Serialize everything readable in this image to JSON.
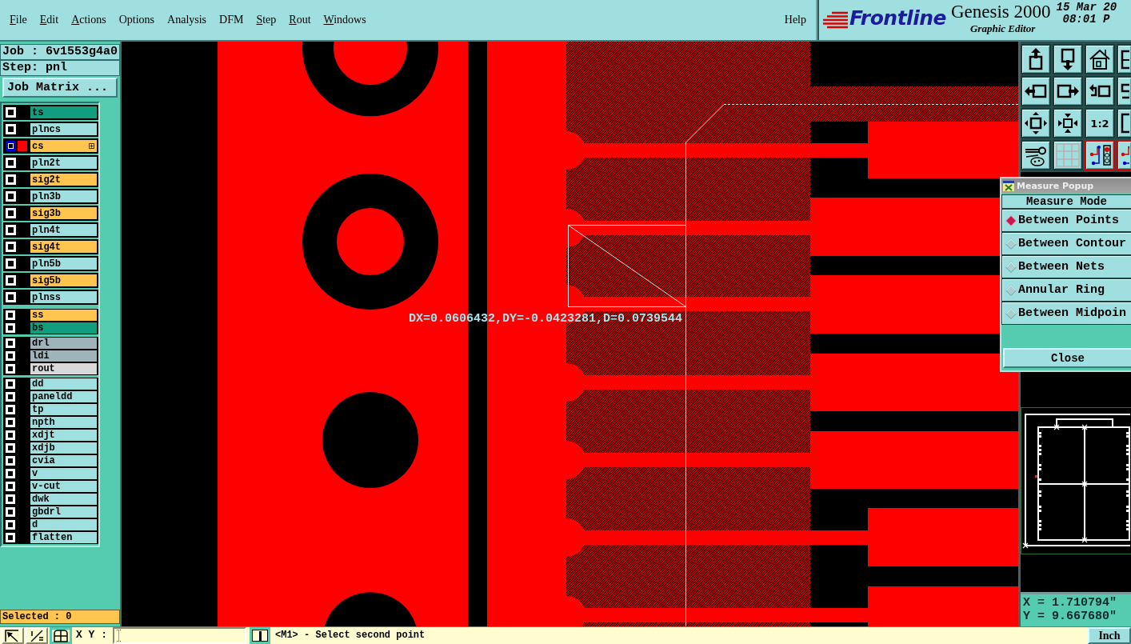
{
  "menu": {
    "items": [
      {
        "label": "File",
        "mnemonic": true
      },
      {
        "label": "Edit",
        "mnemonic": true
      },
      {
        "label": "Actions",
        "mnemonic": true
      },
      {
        "label": "Options",
        "mnemonic": false
      },
      {
        "label": "Analysis",
        "mnemonic": false
      },
      {
        "label": "DFM",
        "mnemonic": false
      },
      {
        "label": "Step",
        "mnemonic": true
      },
      {
        "label": "Rout",
        "mnemonic": true
      },
      {
        "label": "Windows",
        "mnemonic": true
      }
    ],
    "help": {
      "label": "Help",
      "mnemonic": false
    }
  },
  "brand": {
    "logo": "Frontline",
    "product": "Genesis 2000",
    "subtitle": "Graphic Editor",
    "date": "15 Mar 20",
    "time": "08:01 P"
  },
  "job_panel": {
    "job": "Job : 6v1553g4a0",
    "step": "Step: pnl",
    "matrix_button": "Job Matrix ...",
    "layer_groups": [
      {
        "kind": "spaced",
        "layers": [
          {
            "name": "ts",
            "color": "#129e7e",
            "affected": false,
            "selected": false
          },
          {
            "name": "plncs",
            "color": "#9fdfdf",
            "affected": false,
            "selected": false
          },
          {
            "name": "cs",
            "color": "#ffc54e",
            "affected": true,
            "selected": true,
            "display": {
              "color": "#ff0000"
            }
          },
          {
            "name": "pln2t",
            "color": "#9fdfdf",
            "affected": false,
            "selected": false
          },
          {
            "name": "sig2t",
            "color": "#ffc54e",
            "affected": false,
            "selected": false
          },
          {
            "name": "pln3b",
            "color": "#9fdfdf",
            "affected": false,
            "selected": false
          },
          {
            "name": "sig3b",
            "color": "#ffc54e",
            "affected": false,
            "selected": false
          },
          {
            "name": "pln4t",
            "color": "#9fdfdf",
            "affected": false,
            "selected": false
          },
          {
            "name": "sig4t",
            "color": "#ffc54e",
            "affected": false,
            "selected": false
          },
          {
            "name": "pln5b",
            "color": "#9fdfdf",
            "affected": false,
            "selected": false
          },
          {
            "name": "sig5b",
            "color": "#ffc54e",
            "affected": false,
            "selected": false
          },
          {
            "name": "plnss",
            "color": "#9fdfdf",
            "affected": false,
            "selected": false
          }
        ]
      },
      {
        "kind": "stacked",
        "layers": [
          {
            "name": "ss",
            "color": "#ffc54e",
            "affected": false,
            "selected": false
          },
          {
            "name": "bs",
            "color": "#129e7e",
            "affected": false,
            "selected": false
          }
        ]
      },
      {
        "kind": "stacked",
        "layers": [
          {
            "name": "drl",
            "color": "#9fb3bb",
            "affected": false,
            "selected": false
          },
          {
            "name": "ldi",
            "color": "#9fb3bb",
            "affected": false,
            "selected": false
          },
          {
            "name": "rout",
            "color": "#d9d9d9",
            "affected": false,
            "selected": false
          }
        ]
      },
      {
        "kind": "stacked",
        "layers": [
          {
            "name": "dd",
            "color": "#9fdfdf",
            "affected": false,
            "selected": false
          },
          {
            "name": "paneldd",
            "color": "#9fdfdf",
            "affected": false,
            "selected": false
          },
          {
            "name": "tp",
            "color": "#9fdfdf",
            "affected": false,
            "selected": false
          },
          {
            "name": "npth",
            "color": "#9fdfdf",
            "affected": false,
            "selected": false
          },
          {
            "name": "xdjt",
            "color": "#9fdfdf",
            "affected": false,
            "selected": false
          },
          {
            "name": "xdjb",
            "color": "#9fdfdf",
            "affected": false,
            "selected": false
          },
          {
            "name": "cvia",
            "color": "#9fdfdf",
            "affected": false,
            "selected": false
          },
          {
            "name": "v",
            "color": "#9fdfdf",
            "affected": false,
            "selected": false
          },
          {
            "name": "v-cut",
            "color": "#9fdfdf",
            "affected": false,
            "selected": false
          },
          {
            "name": "dwk",
            "color": "#9fdfdf",
            "affected": false,
            "selected": false
          },
          {
            "name": "gbdrl",
            "color": "#9fdfdf",
            "affected": false,
            "selected": false
          },
          {
            "name": "d",
            "color": "#9fdfdf",
            "affected": false,
            "selected": false
          },
          {
            "name": "flatten",
            "color": "#9fdfdf",
            "affected": false,
            "selected": false
          }
        ]
      }
    ],
    "selected_count": "Selected : 0"
  },
  "canvas": {
    "measurement": "DX=0.0606432,DY=-0.0423281,D=0.0739544"
  },
  "toolbar": {
    "buttons": [
      {
        "kind": "icon",
        "on": false
      },
      {
        "kind": "icon",
        "on": false
      },
      {
        "kind": "icon",
        "on": false
      },
      {
        "kind": "icon",
        "on": false
      },
      {
        "kind": "icon",
        "on": false
      },
      {
        "kind": "icon",
        "on": false
      },
      {
        "kind": "icon",
        "on": false
      },
      {
        "kind": "icon",
        "on": false
      },
      {
        "kind": "icon",
        "on": false
      },
      {
        "kind": "icon",
        "on": false
      },
      {
        "kind": "text",
        "label": "1:2",
        "on": false
      },
      {
        "kind": "icon",
        "on": false
      },
      {
        "kind": "icon",
        "on": false
      },
      {
        "kind": "icon",
        "on": false
      },
      {
        "kind": "icon",
        "on": true
      },
      {
        "kind": "icon",
        "on": true
      }
    ]
  },
  "measure_popup": {
    "title": "Measure Popup",
    "heading": "Measure Mode",
    "modes": [
      {
        "label": "Between Points",
        "selected": true
      },
      {
        "label": "Between Contour",
        "selected": false
      },
      {
        "label": "Between Nets",
        "selected": false
      },
      {
        "label": "Annular Ring",
        "selected": false
      },
      {
        "label": "Between Midpoin",
        "selected": false
      }
    ],
    "close_label": "Close"
  },
  "coordinates": {
    "x": "X = 1.710794\"",
    "y": "Y = 9.667680\""
  },
  "status_bar": {
    "tools": [
      {
        "on": false
      },
      {
        "on": false
      },
      {
        "on": true
      }
    ],
    "xy_label": "X Y :",
    "message": "<M1> - Select second point",
    "units_button": "Inch"
  }
}
